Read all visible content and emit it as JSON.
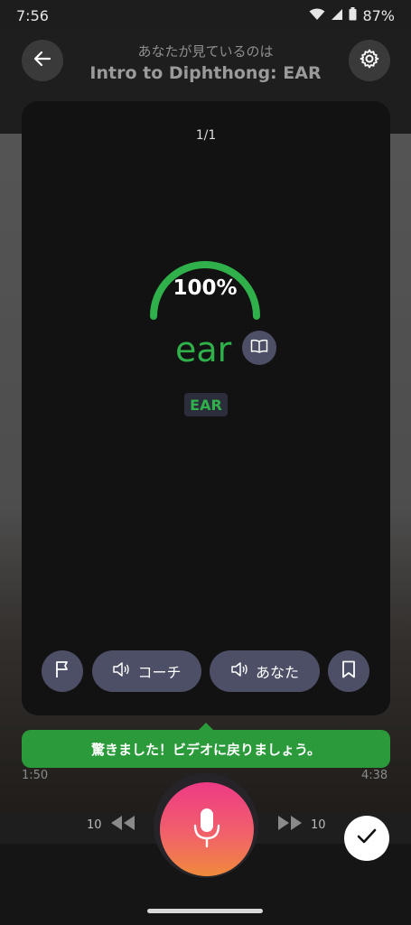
{
  "status_bar": {
    "time": "7:56",
    "battery": "87%"
  },
  "header": {
    "subtitle": "あなたが見ているのは",
    "title": "Intro to Diphthong: EAR"
  },
  "card": {
    "page_indicator": "1/1",
    "score_percent": 100,
    "score_label": "100%",
    "word": "ear",
    "phoneme": "EAR",
    "actions": {
      "coach_label": "コーチ",
      "you_label": "あなた"
    }
  },
  "toast": {
    "message": "驚きました！ビデオに戻りましょう。"
  },
  "video": {
    "current_time": "1:50",
    "total_time": "4:38"
  },
  "controls": {
    "rewind_seconds": "10",
    "forward_seconds": "10"
  },
  "colors": {
    "accent_green": "#2fb04a",
    "toast_green": "#2a9a3a",
    "button_bg": "#4d4f66",
    "mic_gradient_top": "#ee3a86",
    "mic_gradient_bottom": "#f08a3c"
  },
  "icons": [
    "wifi-icon",
    "signal-icon",
    "battery-icon",
    "back-arrow-icon",
    "gear-icon",
    "book-icon",
    "flag-icon",
    "speaker-icon",
    "bookmark-icon",
    "rewind-icon",
    "fast-forward-icon",
    "microphone-icon",
    "checkmark-icon"
  ]
}
